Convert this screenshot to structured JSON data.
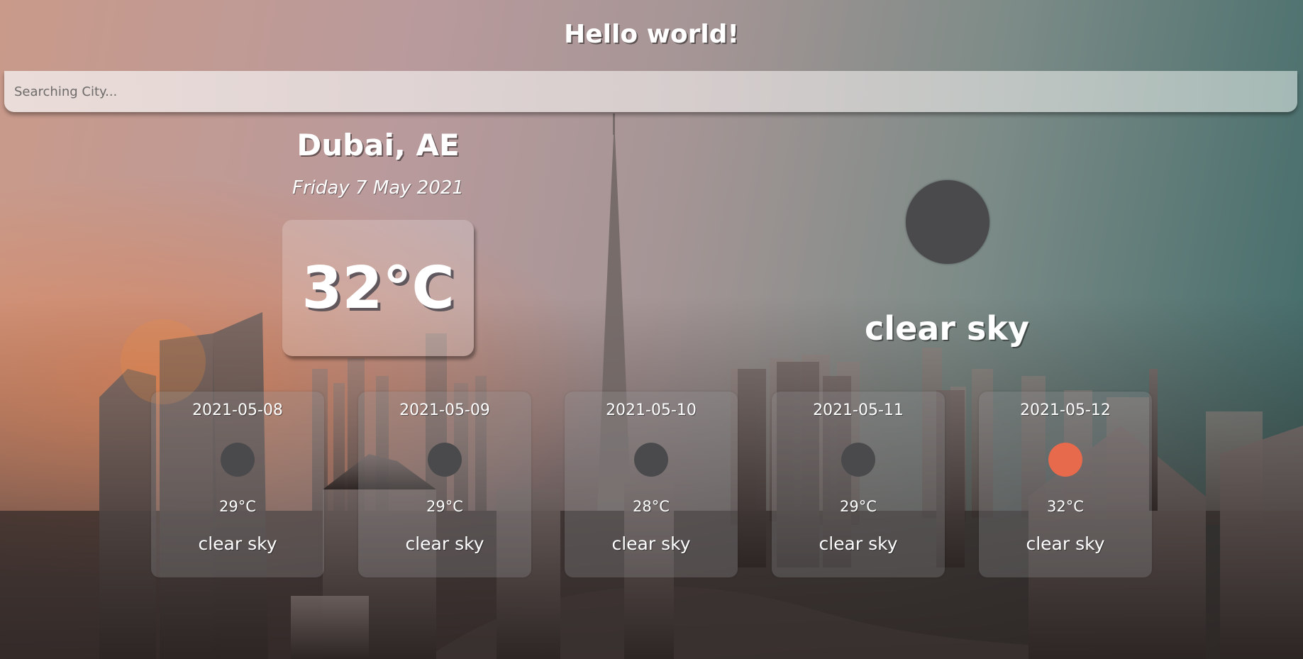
{
  "header": {
    "title": "Hello world!"
  },
  "search": {
    "placeholder": "Searching City..."
  },
  "current": {
    "location": "Dubai, AE",
    "date": "Friday 7 May 2021",
    "temperature": "32°C",
    "description": "clear sky",
    "icon": "clear-sky-icon",
    "icon_color": "#4a4a4c"
  },
  "forecast": [
    {
      "date": "2021-05-08",
      "temp": "29°C",
      "description": "clear sky",
      "icon": "clear-sky-icon",
      "icon_color": "#4a4a4c"
    },
    {
      "date": "2021-05-09",
      "temp": "29°C",
      "description": "clear sky",
      "icon": "clear-sky-icon",
      "icon_color": "#4a4a4c"
    },
    {
      "date": "2021-05-10",
      "temp": "28°C",
      "description": "clear sky",
      "icon": "clear-sky-icon",
      "icon_color": "#4a4a4c"
    },
    {
      "date": "2021-05-11",
      "temp": "29°C",
      "description": "clear sky",
      "icon": "clear-sky-icon",
      "icon_color": "#4a4a4c"
    },
    {
      "date": "2021-05-12",
      "temp": "32°C",
      "description": "clear sky",
      "icon": "clear-sky-icon",
      "icon_color": "#e76a4c"
    }
  ]
}
